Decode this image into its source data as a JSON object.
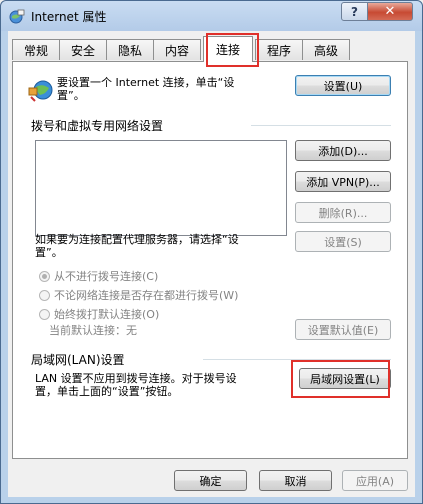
{
  "window": {
    "title": "Internet 属性",
    "help_label": "?",
    "close_label": "✕"
  },
  "tabs": [
    {
      "label": "常规"
    },
    {
      "label": "安全"
    },
    {
      "label": "隐私"
    },
    {
      "label": "内容"
    },
    {
      "label": "连接",
      "active": true
    },
    {
      "label": "程序"
    },
    {
      "label": "高级"
    }
  ],
  "setup": {
    "text_line1": "要设置一个 Internet 连接，单击“设",
    "text_line2": "置”。",
    "button": "设置(U)"
  },
  "dialup": {
    "header": "拨号和虚拟专用网络设置",
    "add_button": "添加(D)...",
    "add_vpn_button": "添加 VPN(P)...",
    "remove_button": "删除(R)...",
    "proxy_text_line1": "如果要为连接配置代理服务器，请选择“设",
    "proxy_text_line2": "置”。",
    "settings_button": "设置(S)",
    "options": [
      {
        "label": "从不进行拨号连接(C)",
        "selected": true
      },
      {
        "label": "不论网络连接是否存在都进行拨号(W)",
        "selected": false
      },
      {
        "label": "始终拨打默认连接(O)",
        "selected": false
      }
    ],
    "current_default_label": "当前默认连接：",
    "current_default_value": "无",
    "set_default_button": "设置默认值(E)"
  },
  "lan": {
    "header": "局域网(LAN)设置",
    "text_line1": "LAN 设置不应用到拨号连接。对于拨号设",
    "text_line2": "置，单击上面的“设置”按钮。",
    "button": "局域网设置(L)"
  },
  "footer": {
    "ok": "确定",
    "cancel": "取消",
    "apply": "应用(A)"
  },
  "colors": {
    "highlight_box": "#e0302a"
  }
}
